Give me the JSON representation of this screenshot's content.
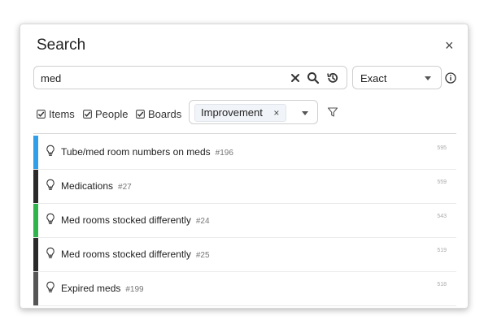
{
  "dialog": {
    "title": "Search",
    "close_glyph": "×"
  },
  "search": {
    "value": "med",
    "placeholder": "",
    "icons": [
      "clear-icon",
      "search-icon",
      "history-icon"
    ]
  },
  "match_mode": {
    "value": "Exact"
  },
  "filters": {
    "items_label": "Items",
    "people_label": "People",
    "boards_label": "Boards",
    "items_checked": true,
    "people_checked": true,
    "boards_checked": true,
    "tag": "Improvement",
    "tag_remove_glyph": "×"
  },
  "results": [
    {
      "title": "Tube/med room numbers on meds",
      "id": "#196",
      "score": "595",
      "color": "#2f9fe9",
      "icon": "lightbulb-icon"
    },
    {
      "title": "Medications",
      "id": "#27",
      "score": "559",
      "color": "#2a2a2a",
      "icon": "lightbulb-icon"
    },
    {
      "title": "Med rooms stocked differently",
      "id": "#24",
      "score": "543",
      "color": "#2eb44a",
      "icon": "lightbulb-icon"
    },
    {
      "title": "Med rooms stocked differently",
      "id": "#25",
      "score": "519",
      "color": "#2a2a2a",
      "icon": "lightbulb-icon"
    },
    {
      "title": "Expired meds",
      "id": "#199",
      "score": "518",
      "color": "#555555",
      "icon": "lightbulb-icon"
    }
  ]
}
